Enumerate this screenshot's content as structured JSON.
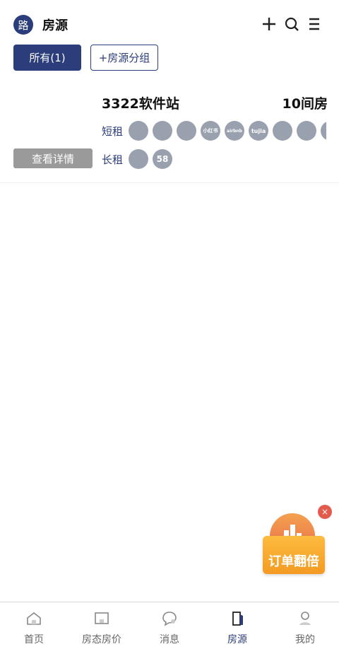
{
  "header": {
    "logo_char": "路",
    "title": "房源",
    "icons": [
      "plus-icon",
      "search-icon",
      "menu-icon"
    ]
  },
  "groups": {
    "all_label": "所有(1)",
    "add_label": "+房源分组"
  },
  "listing": {
    "name": "3322软件站",
    "room_count": "10间房",
    "short_rent_label": "短租",
    "long_rent_label": "长租",
    "short_channels": [
      "",
      "",
      "",
      "小红书",
      "airbnb",
      "tujia",
      "",
      "",
      ""
    ],
    "long_channels": [
      "",
      "58"
    ],
    "details_button": "查看详情"
  },
  "promo": {
    "text": "订单翻倍",
    "close": "×"
  },
  "nav": [
    {
      "label": "首页"
    },
    {
      "label": "房态房价"
    },
    {
      "label": "消息"
    },
    {
      "label": "房源"
    },
    {
      "label": "我的"
    }
  ],
  "colors": {
    "primary": "#2b3d7a",
    "channel_gray": "#9aa1ae",
    "promo_orange": "#f39a22"
  }
}
